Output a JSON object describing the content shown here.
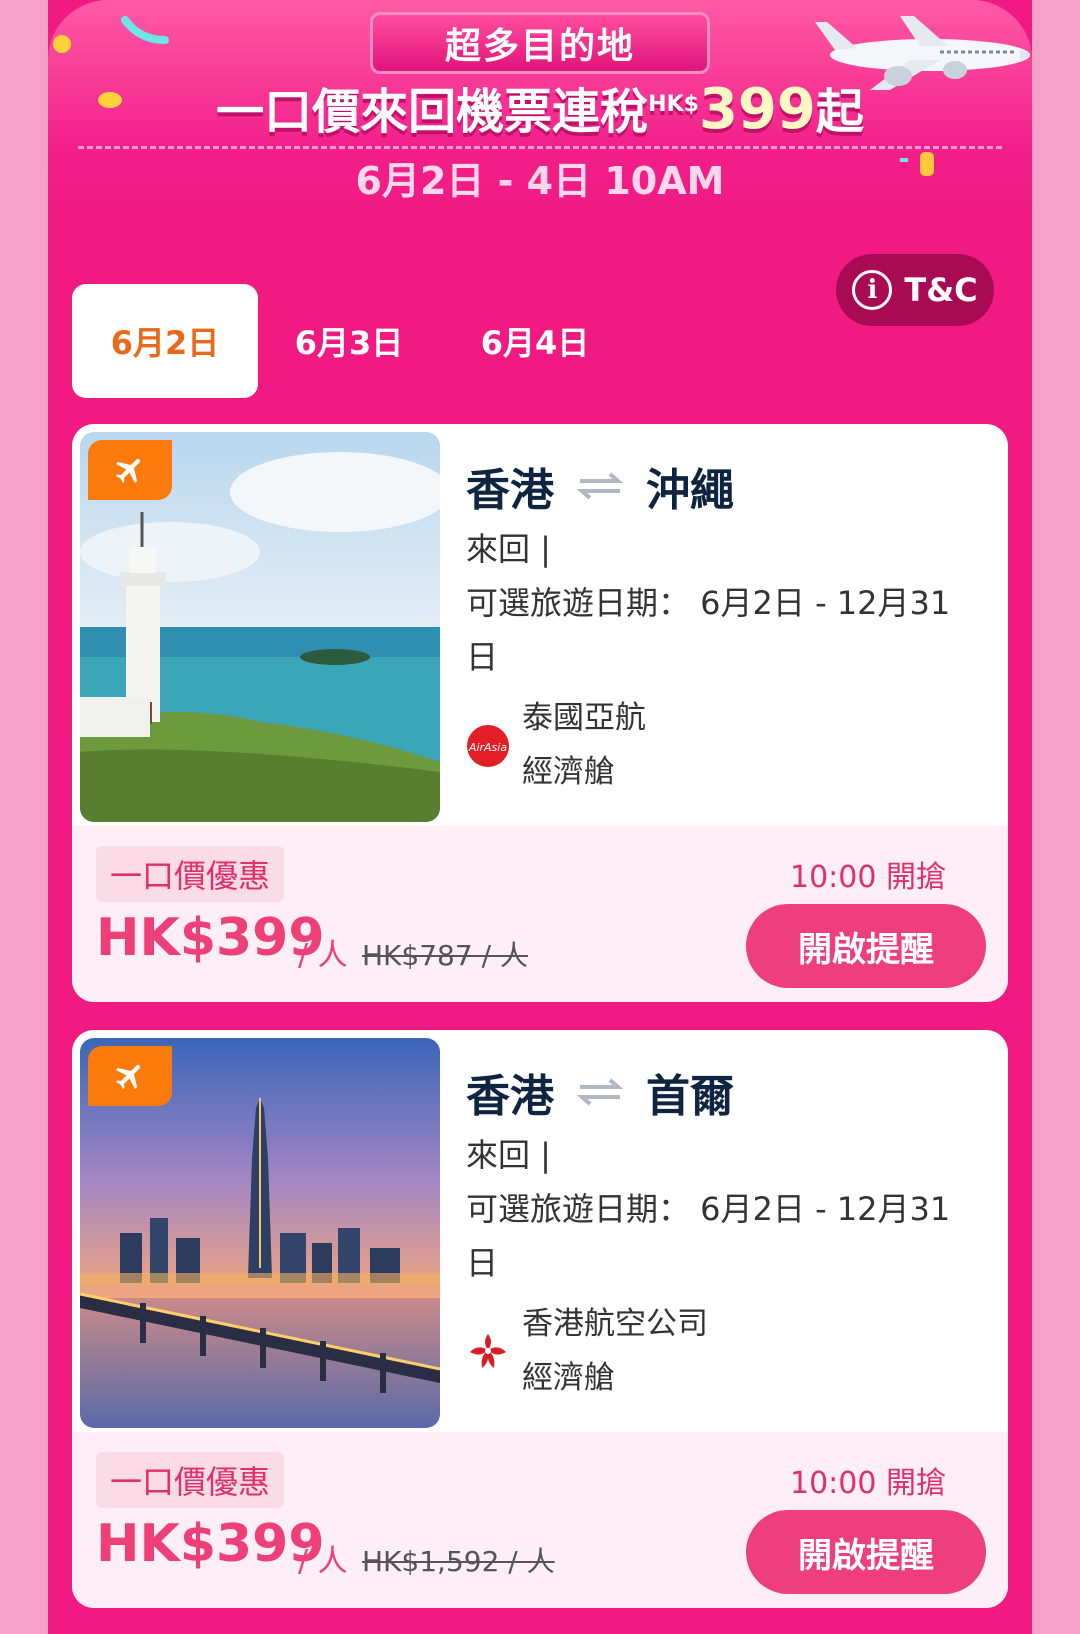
{
  "banner": {
    "tab_label": "超多目的地",
    "headline_prefix": "一口價來回機票連稅",
    "currency_small": "HK$",
    "headline_price": "399",
    "headline_suffix": "起",
    "date_range": "6月2日 - 4日 10AM"
  },
  "tc_label": "T&C",
  "tabs": [
    {
      "label": "6月2日",
      "active": true
    },
    {
      "label": "6月3日",
      "active": false
    },
    {
      "label": "6月4日",
      "active": false
    }
  ],
  "cards": [
    {
      "from": "香港",
      "to": "沖繩",
      "trip_type": "來回 |",
      "dates": "可選旅遊日期： 6月2日 - 12月31日",
      "airline": "泰國亞航",
      "cabin": "經濟艙",
      "deal_tag": "一口價優惠",
      "price": "HK$399",
      "unit": "/ 人",
      "original_price": "HK$787 / 人",
      "start_time": "10:00 開搶",
      "button": "開啟提醒",
      "image": "lighthouse-coast",
      "airline_logo": "airasia-logo"
    },
    {
      "from": "香港",
      "to": "首爾",
      "trip_type": "來回 |",
      "dates": "可選旅遊日期： 6月2日 - 12月31日",
      "airline": "香港航空公司",
      "cabin": "經濟艙",
      "deal_tag": "一口價優惠",
      "price": "HK$399",
      "unit": "/ 人",
      "original_price": "HK$1,592 / 人",
      "start_time": "10:00 開搶",
      "button": "開啟提醒",
      "image": "seoul-skyline-night",
      "airline_logo": "hk-airlines-logo"
    }
  ],
  "colors": {
    "page_bg": "#f7a1c9",
    "panel": "#f01a82",
    "price": "#ef3f79",
    "active_tab_text": "#e8681c",
    "badge": "#fa7a0c"
  }
}
